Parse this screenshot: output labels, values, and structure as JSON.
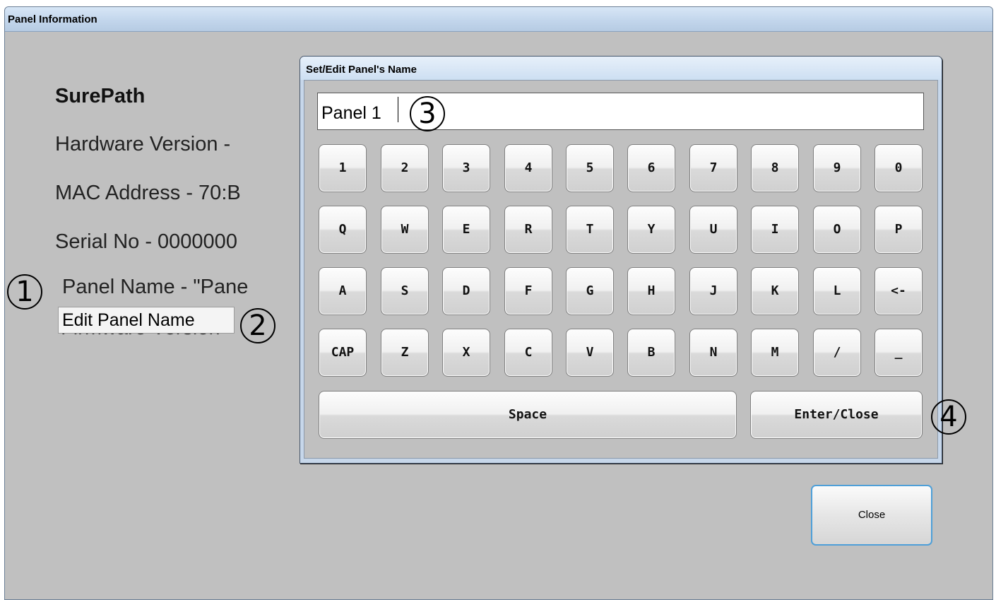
{
  "window": {
    "title": "Panel Information"
  },
  "info": {
    "brand": "SurePath",
    "hardware": "Hardware Version  - ",
    "mac": "MAC Address  - 70:B",
    "serial": "Serial No  - 0000000",
    "panel_name": "Panel Name  - \"Pane",
    "firmware": "Firmware Version  - "
  },
  "edit_button": {
    "label": "Edit Panel Name"
  },
  "close_button": {
    "label": "Close"
  },
  "callouts": [
    "1",
    "2",
    "3",
    "4"
  ],
  "dialog": {
    "title": "Set/Edit Panel's Name",
    "input_value": "Panel 1",
    "rows": [
      [
        "1",
        "2",
        "3",
        "4",
        "5",
        "6",
        "7",
        "8",
        "9",
        "0"
      ],
      [
        "Q",
        "W",
        "E",
        "R",
        "T",
        "Y",
        "U",
        "I",
        "O",
        "P"
      ],
      [
        "A",
        "S",
        "D",
        "F",
        "G",
        "H",
        "J",
        "K",
        "L",
        "<-"
      ],
      [
        "CAP",
        "Z",
        "X",
        "C",
        "V",
        "B",
        "N",
        "M",
        "/",
        "_"
      ]
    ],
    "space_label": "Space",
    "enter_label": "Enter/Close"
  }
}
